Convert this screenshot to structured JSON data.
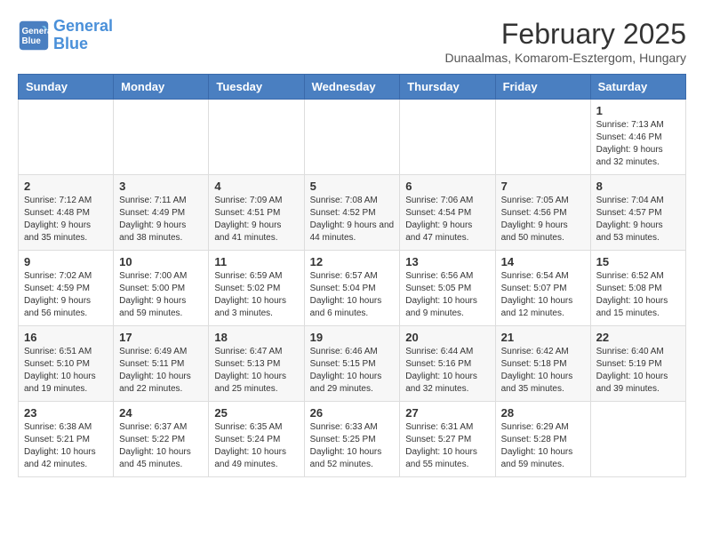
{
  "header": {
    "logo_line1": "General",
    "logo_line2": "Blue",
    "month": "February 2025",
    "location": "Dunaalmas, Komarom-Esztergom, Hungary"
  },
  "days_of_week": [
    "Sunday",
    "Monday",
    "Tuesday",
    "Wednesday",
    "Thursday",
    "Friday",
    "Saturday"
  ],
  "weeks": [
    [
      {
        "day": "",
        "info": ""
      },
      {
        "day": "",
        "info": ""
      },
      {
        "day": "",
        "info": ""
      },
      {
        "day": "",
        "info": ""
      },
      {
        "day": "",
        "info": ""
      },
      {
        "day": "",
        "info": ""
      },
      {
        "day": "1",
        "info": "Sunrise: 7:13 AM\nSunset: 4:46 PM\nDaylight: 9 hours and 32 minutes."
      }
    ],
    [
      {
        "day": "2",
        "info": "Sunrise: 7:12 AM\nSunset: 4:48 PM\nDaylight: 9 hours and 35 minutes."
      },
      {
        "day": "3",
        "info": "Sunrise: 7:11 AM\nSunset: 4:49 PM\nDaylight: 9 hours and 38 minutes."
      },
      {
        "day": "4",
        "info": "Sunrise: 7:09 AM\nSunset: 4:51 PM\nDaylight: 9 hours and 41 minutes."
      },
      {
        "day": "5",
        "info": "Sunrise: 7:08 AM\nSunset: 4:52 PM\nDaylight: 9 hours and 44 minutes."
      },
      {
        "day": "6",
        "info": "Sunrise: 7:06 AM\nSunset: 4:54 PM\nDaylight: 9 hours and 47 minutes."
      },
      {
        "day": "7",
        "info": "Sunrise: 7:05 AM\nSunset: 4:56 PM\nDaylight: 9 hours and 50 minutes."
      },
      {
        "day": "8",
        "info": "Sunrise: 7:04 AM\nSunset: 4:57 PM\nDaylight: 9 hours and 53 minutes."
      }
    ],
    [
      {
        "day": "9",
        "info": "Sunrise: 7:02 AM\nSunset: 4:59 PM\nDaylight: 9 hours and 56 minutes."
      },
      {
        "day": "10",
        "info": "Sunrise: 7:00 AM\nSunset: 5:00 PM\nDaylight: 9 hours and 59 minutes."
      },
      {
        "day": "11",
        "info": "Sunrise: 6:59 AM\nSunset: 5:02 PM\nDaylight: 10 hours and 3 minutes."
      },
      {
        "day": "12",
        "info": "Sunrise: 6:57 AM\nSunset: 5:04 PM\nDaylight: 10 hours and 6 minutes."
      },
      {
        "day": "13",
        "info": "Sunrise: 6:56 AM\nSunset: 5:05 PM\nDaylight: 10 hours and 9 minutes."
      },
      {
        "day": "14",
        "info": "Sunrise: 6:54 AM\nSunset: 5:07 PM\nDaylight: 10 hours and 12 minutes."
      },
      {
        "day": "15",
        "info": "Sunrise: 6:52 AM\nSunset: 5:08 PM\nDaylight: 10 hours and 15 minutes."
      }
    ],
    [
      {
        "day": "16",
        "info": "Sunrise: 6:51 AM\nSunset: 5:10 PM\nDaylight: 10 hours and 19 minutes."
      },
      {
        "day": "17",
        "info": "Sunrise: 6:49 AM\nSunset: 5:11 PM\nDaylight: 10 hours and 22 minutes."
      },
      {
        "day": "18",
        "info": "Sunrise: 6:47 AM\nSunset: 5:13 PM\nDaylight: 10 hours and 25 minutes."
      },
      {
        "day": "19",
        "info": "Sunrise: 6:46 AM\nSunset: 5:15 PM\nDaylight: 10 hours and 29 minutes."
      },
      {
        "day": "20",
        "info": "Sunrise: 6:44 AM\nSunset: 5:16 PM\nDaylight: 10 hours and 32 minutes."
      },
      {
        "day": "21",
        "info": "Sunrise: 6:42 AM\nSunset: 5:18 PM\nDaylight: 10 hours and 35 minutes."
      },
      {
        "day": "22",
        "info": "Sunrise: 6:40 AM\nSunset: 5:19 PM\nDaylight: 10 hours and 39 minutes."
      }
    ],
    [
      {
        "day": "23",
        "info": "Sunrise: 6:38 AM\nSunset: 5:21 PM\nDaylight: 10 hours and 42 minutes."
      },
      {
        "day": "24",
        "info": "Sunrise: 6:37 AM\nSunset: 5:22 PM\nDaylight: 10 hours and 45 minutes."
      },
      {
        "day": "25",
        "info": "Sunrise: 6:35 AM\nSunset: 5:24 PM\nDaylight: 10 hours and 49 minutes."
      },
      {
        "day": "26",
        "info": "Sunrise: 6:33 AM\nSunset: 5:25 PM\nDaylight: 10 hours and 52 minutes."
      },
      {
        "day": "27",
        "info": "Sunrise: 6:31 AM\nSunset: 5:27 PM\nDaylight: 10 hours and 55 minutes."
      },
      {
        "day": "28",
        "info": "Sunrise: 6:29 AM\nSunset: 5:28 PM\nDaylight: 10 hours and 59 minutes."
      },
      {
        "day": "",
        "info": ""
      }
    ]
  ]
}
